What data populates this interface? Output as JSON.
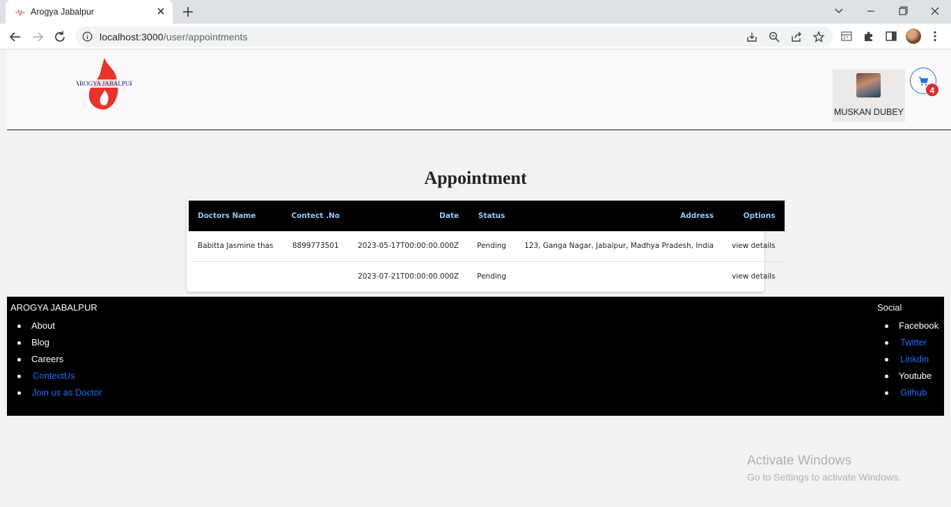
{
  "browser": {
    "tab_title": "Arogya Jabalpur",
    "url_host": "localhost:3000",
    "url_path": "/user/appointments"
  },
  "header": {
    "logo_text": "AROGYA JABALPUR",
    "user_name": "MUSKAN DUBEY",
    "cart_count": "4"
  },
  "main": {
    "heading": "Appointment",
    "table": {
      "columns": [
        "Doctors Name",
        "Contect .No",
        "Date",
        "Status",
        "Address",
        "Options"
      ],
      "rows": [
        [
          "Babitta Jasmine thas",
          "8899773501",
          "2023-05-17T00:00:00.000Z",
          "Pending",
          "123, Ganga Nagar, Jabalpur, Madhya Pradesh, India",
          "view details"
        ],
        [
          "",
          "",
          "2023-07-21T00:00:00.000Z",
          "Pending",
          "",
          "view details"
        ]
      ]
    }
  },
  "footer": {
    "brand": "AROGYA JABALPUR",
    "links": [
      "About",
      "Blog",
      "Careers",
      "ContectUs",
      "Join us as Doctor"
    ],
    "social_heading": "Social",
    "social": [
      "Facebook",
      "Twitter",
      "Linkdin",
      "Youtube",
      "Github"
    ]
  },
  "watermark": {
    "line1": "Activate Windows",
    "line2": "Go to Settings to activate Windows."
  },
  "colors": {
    "link_blue": "#1e6cff",
    "header_text": "#90caf9",
    "logo_red": "#e8322a",
    "badge_red": "#d32f2f"
  }
}
